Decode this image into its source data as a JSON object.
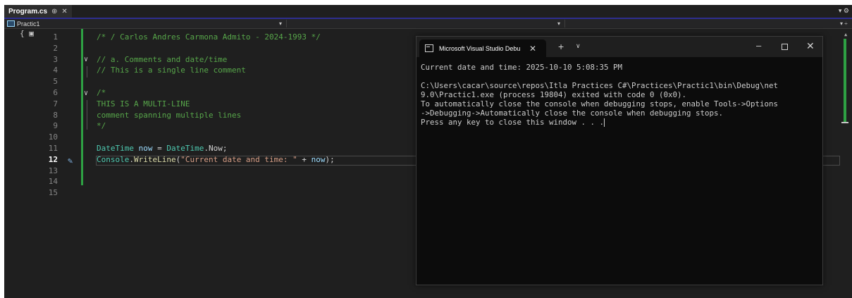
{
  "tab": {
    "title": "Program.cs",
    "pin": "⊕",
    "close": "✕"
  },
  "navbar": {
    "project": "Practic1"
  },
  "editor": {
    "line_numbers": [
      "1",
      "2",
      "3",
      "4",
      "5",
      "6",
      "7",
      "8",
      "9",
      "10",
      "11",
      "12",
      "13",
      "14",
      "15"
    ],
    "active_line": "12",
    "lines": {
      "l1": "/* / Carlos Andres Carmona Admito - 2024-1993 */",
      "l3": "// a. Comments and date/time",
      "l4": "// This is a single line comment",
      "l6": "/*",
      "l7": "THIS IS A MULTI-LINE",
      "l8": "comment spanning multiple lines",
      "l9": "*/",
      "l11": {
        "t1": "DateTime",
        "t2": " ",
        "t3": "now",
        "t4": " = ",
        "t5": "DateTime",
        "t6": ".Now;"
      },
      "l12": {
        "t1": "Console",
        "t2": ".",
        "t3": "WriteLine",
        "t4": "(",
        "t5": "\"Current date and time: \"",
        "t6": " + ",
        "t7": "now",
        "t8": ");"
      }
    }
  },
  "console": {
    "title": "Microsoft Visual Studio Debu",
    "lines": [
      "Current date and time: 2025-10-10 5:08:35 PM",
      "",
      "C:\\Users\\cacar\\source\\repos\\Itla Practices C#\\Practices\\Practic1\\bin\\Debug\\net",
      "9.0\\Practic1.exe (process 19804) exited with code 0 (0x0).",
      "To automatically close the console when debugging stops, enable Tools->Options",
      "->Debugging->Automatically close the console when debugging stops.",
      "Press any key to close this window . . ."
    ]
  },
  "colors": {
    "comment": "#57a64a",
    "type": "#4ec9b0",
    "variable": "#9cdcfe",
    "method": "#dcdcaa",
    "string": "#d69d85",
    "change_bar": "#2ea043"
  },
  "icons": [
    "pin-icon",
    "close-icon",
    "project-icon",
    "csharp-file-icon",
    "fold-icon",
    "quick-action-brush-icon",
    "console-icon",
    "plus-icon",
    "chevron-down-icon",
    "minimize-icon",
    "maximize-icon"
  ]
}
